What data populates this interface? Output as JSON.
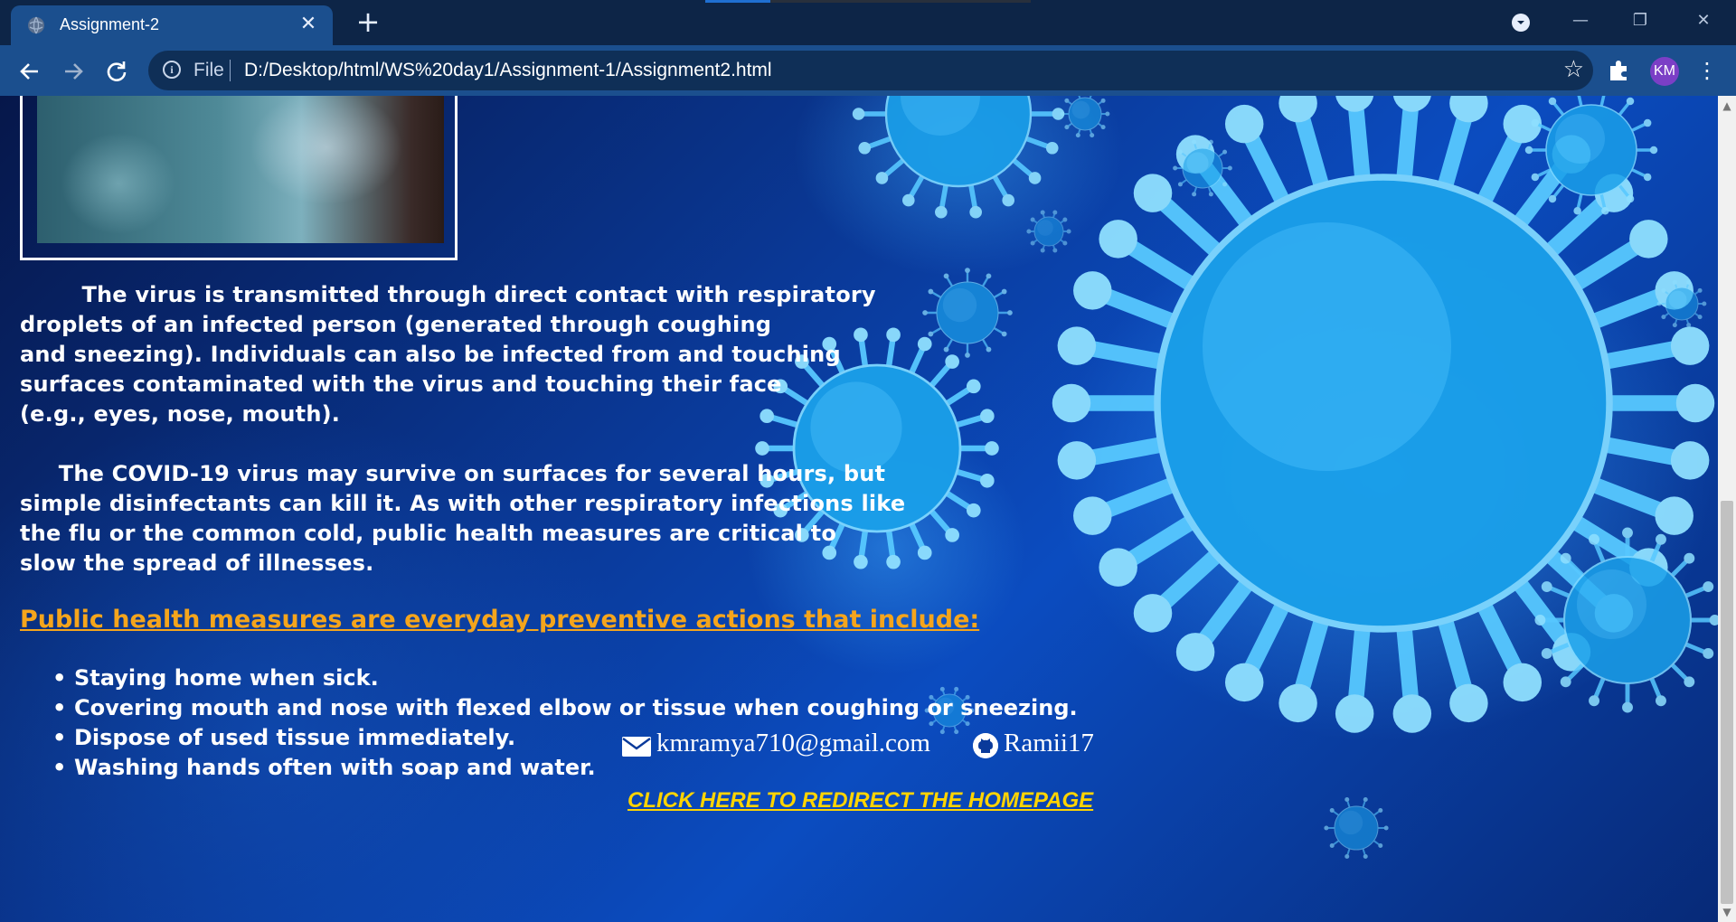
{
  "browser": {
    "tab_title": "Assignment-2",
    "tab_close": "✕",
    "new_tab": "+",
    "url_scheme": "File",
    "url": "D:/Desktop/html/WS%20day1/Assignment-1/Assignment2.html",
    "profile_initials": "KM",
    "icons": [
      "back-arrow-icon",
      "forward-arrow-icon",
      "reload-icon",
      "info-icon",
      "bookmark-star-icon",
      "extensions-puzzle-icon",
      "kebab-menu-icon"
    ]
  },
  "page": {
    "paragraph1": "        The virus is transmitted through direct contact with respiratory\ndroplets of an infected person (generated through coughing\nand sneezing). Individuals can also be infected from and touching\nsurfaces contaminated with the virus and touching their face\n(e.g., eyes, nose, mouth).",
    "paragraph2": "     The COVID-19 virus may survive on surfaces for several hours, but\nsimple disinfectants can kill it. As with other respiratory infections like\nthe flu or the common cold, public health measures are critical to\nslow the spread of illnesses.",
    "measures_heading": "Public health measures are everyday preventive actions that include:",
    "measures": [
      "Staying home when sick.",
      "Covering mouth and nose with flexed elbow or tissue when coughing or sneezing.",
      "Dispose of used tissue immediately.",
      "Washing hands often with soap and water."
    ],
    "email": "kmramya710@gmail.com",
    "github": "Ramii17",
    "redirect_link": "CLICK HERE TO REDIRECT THE HOMEPAGE"
  },
  "colors": {
    "heading": "#f5a51c",
    "link": "#ffd400",
    "toolbar": "#1b4f8e",
    "titlebar": "#0d2547"
  }
}
